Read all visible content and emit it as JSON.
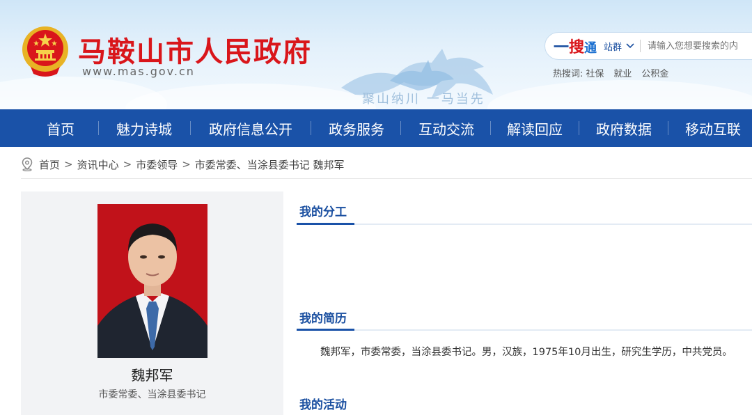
{
  "header": {
    "site_title": "马鞍山市人民政府",
    "site_url": "www.mas.gov.cn",
    "slogan": "聚山纳川 一马当先",
    "emblem_icon": "national-emblem-icon"
  },
  "search": {
    "logo_yi": "一",
    "logo_sou": "搜",
    "logo_tong": "通",
    "station_label": "站群",
    "placeholder": "请输入您想要搜索的内",
    "hot_label": "热搜词:",
    "hot_words": [
      "社保",
      "就业",
      "公积金"
    ]
  },
  "nav": {
    "items": [
      "首页",
      "魅力诗城",
      "政府信息公开",
      "政务服务",
      "互动交流",
      "解读回应",
      "政府数据",
      "移动互联"
    ]
  },
  "breadcrumb": {
    "items": [
      "首页",
      "资讯中心",
      "市委领导",
      "市委常委、当涂县委书记 魏邦军"
    ],
    "separator": ">"
  },
  "profile": {
    "name": "魏邦军",
    "title": "市委常委、当涂县委书记"
  },
  "sections": {
    "duties_title": "我的分工",
    "resume_title": "我的简历",
    "resume_text": "魏邦军，市委常委，当涂县委书记。男，汉族，1975年10月出生，研究生学历，中共党员。",
    "activities_title": "我的活动"
  },
  "colors": {
    "brand_red": "#d9161b",
    "nav_blue": "#1a52a8",
    "section_blue": "#1a4fa0",
    "photo_bg": "#c1121a"
  }
}
